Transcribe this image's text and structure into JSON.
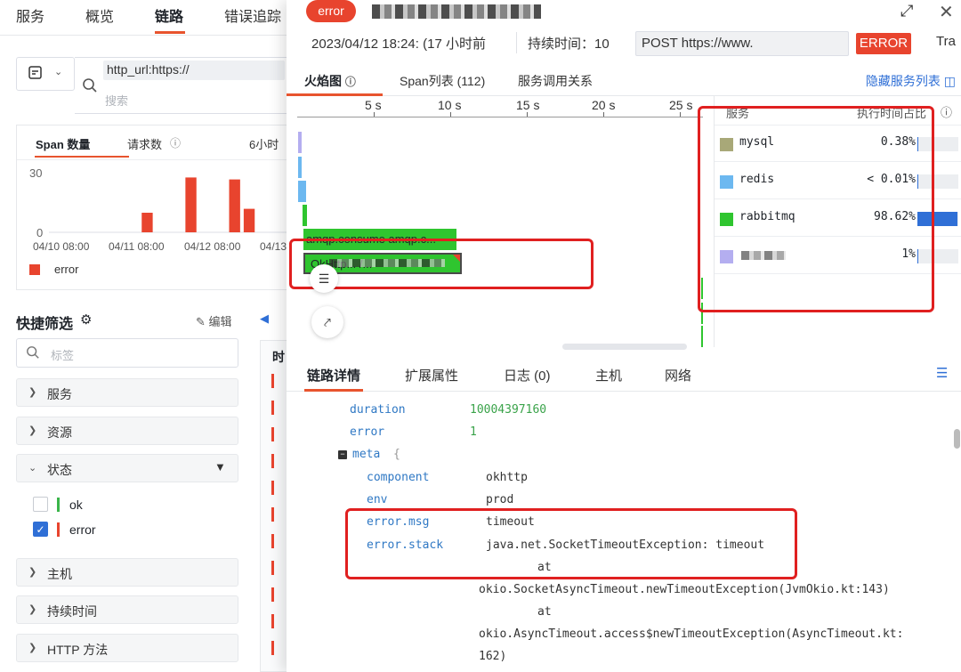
{
  "topnav": {
    "tabs": [
      "服务",
      "概览",
      "链路",
      "错误追踪"
    ],
    "active_index": 2
  },
  "search": {
    "chip_text": "http_url:https://",
    "placeholder": "搜索"
  },
  "chart_card": {
    "tabs": [
      "Span 数量",
      "请求数",
      "6小时"
    ],
    "chart_data": {
      "type": "bar",
      "categories": [
        "04/10 08:00",
        "04/11 08:00",
        "04/12 08:00",
        "04/13"
      ],
      "series": [
        {
          "name": "error",
          "values": [
            0,
            0,
            0,
            0,
            0,
            0,
            10,
            0,
            0,
            28,
            0,
            0,
            27,
            12,
            0,
            0
          ]
        }
      ],
      "ylim": [
        0,
        30
      ],
      "yticks": [
        "30",
        "0"
      ],
      "legend": "bottom-left",
      "color": "#e8442e"
    }
  },
  "quick_filter": {
    "title": "快捷筛选",
    "edit_label": "编辑",
    "tag_placeholder": "标签",
    "facets": [
      "服务",
      "资源",
      "状态",
      "主机",
      "持续时间",
      "HTTP 方法"
    ],
    "status_options": [
      {
        "label": "ok",
        "checked": false,
        "color": "#3ab54a"
      },
      {
        "label": "error",
        "checked": true,
        "color": "#e8442e"
      }
    ],
    "table_header": "时"
  },
  "drawer": {
    "status_badge": "error",
    "timestamp": "2023/04/12 18:24: (17 小时前",
    "duration_label": "持续时间：10",
    "method_url": "POST  https://www.",
    "error_tag": "ERROR",
    "trailing": "Tra",
    "view_tabs": [
      "火焰图",
      "Span列表 (112)",
      "服务调用关系"
    ],
    "hide_link": "隐藏服务列表",
    "ruler_ticks": [
      "5 s",
      "10 s",
      "15 s",
      "20 s",
      "25 s"
    ],
    "spans": [
      {
        "label": "amqp.consume amqp.c..."
      },
      {
        "label": "OkHttp...        /..."
      }
    ],
    "service_table": {
      "header_service": "服务",
      "header_ratio": "执行时间占比",
      "rows": [
        {
          "name": "mysql",
          "pct": "0.38%",
          "fill": 0.0038,
          "color": "#a8a878"
        },
        {
          "name": "redis",
          "pct": "< 0.01%",
          "fill": 0.0001,
          "color": "#6cb8f0"
        },
        {
          "name": "rabbitmq",
          "pct": "98.62%",
          "fill": 0.9862,
          "color": "#2fc52f"
        },
        {
          "name": "",
          "pct": "1%",
          "fill": 0.01,
          "color": "#b4aef0"
        }
      ]
    },
    "detail_tabs": [
      "链路详情",
      "扩展属性",
      "日志 (0)",
      "主机",
      "网络"
    ],
    "detail": {
      "duration_key": "duration",
      "duration_val": "10004397160",
      "error_key": "error",
      "error_val": "1",
      "meta_key": "meta",
      "meta_brace": "{",
      "component_key": "component",
      "component_val": "okhttp",
      "env_key": "env",
      "env_val": "prod",
      "errmsg_key": "error.msg",
      "errmsg_val": "timeout",
      "errstack_key": "error.stack",
      "stack_lines": [
        "java.net.SocketTimeoutException: timeout",
        "at",
        "okio.SocketAsyncTimeout.newTimeoutException(JvmOkio.kt:143)",
        "at",
        "okio.AsyncTimeout.access$newTimeoutException(AsyncTimeout.kt:",
        "162)"
      ]
    }
  }
}
